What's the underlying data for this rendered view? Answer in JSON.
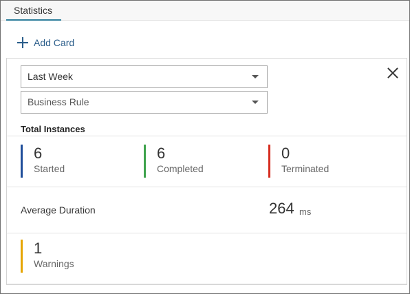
{
  "tabs": [
    {
      "label": "Statistics",
      "active": true
    }
  ],
  "toolbar": {
    "add_card_label": "Add Card"
  },
  "card": {
    "period_select": {
      "value": "Last Week"
    },
    "type_select": {
      "value": "Business Rule"
    },
    "total_instances_title": "Total Instances",
    "stats": {
      "started": {
        "value": "6",
        "label": "Started",
        "color": "#1f4e9a"
      },
      "completed": {
        "value": "6",
        "label": "Completed",
        "color": "#3fa34d"
      },
      "terminated": {
        "value": "0",
        "label": "Terminated",
        "color": "#d62d20"
      }
    },
    "average_duration": {
      "label": "Average Duration",
      "value": "264",
      "unit": "ms"
    },
    "warnings": {
      "value": "1",
      "label": "Warnings",
      "color": "#e6a500"
    }
  },
  "icons": {
    "add": "plus-icon",
    "close": "close-icon",
    "dropdown": "chevron-down-icon"
  },
  "colors": {
    "accent": "#2a5d8a",
    "tab_underline": "#2f7f9c"
  }
}
